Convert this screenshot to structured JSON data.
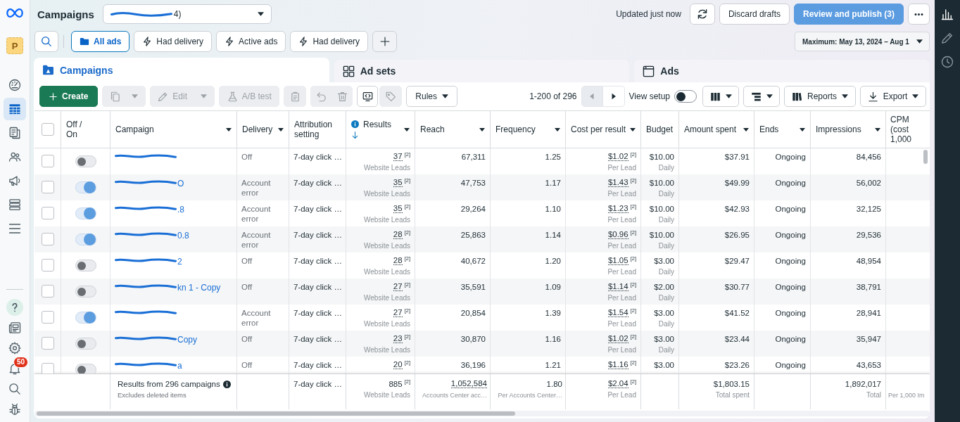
{
  "left_nav": {
    "top": [
      {
        "kind": "logo"
      },
      {
        "kind": "avatar",
        "label": "P"
      },
      {
        "kind": "icon",
        "selected": false
      },
      {
        "kind": "icon",
        "selected": true
      },
      {
        "kind": "icon",
        "selected": false
      },
      {
        "kind": "icon",
        "selected": false
      },
      {
        "kind": "icon",
        "selected": false
      },
      {
        "kind": "icon",
        "selected": false
      },
      {
        "kind": "icon",
        "selected": false
      }
    ],
    "bottom": [
      {
        "selected": false
      },
      {
        "selected": false
      },
      {
        "selected": false
      },
      {
        "selected": false,
        "badge": "50"
      },
      {
        "selected": false
      },
      {
        "selected": false
      }
    ]
  },
  "header": {
    "title": "Campaigns",
    "account_visible_part": "4)",
    "status": "Updated just now",
    "discard": {
      "label": "Discard drafts",
      "disabled": false
    },
    "publish": {
      "label": "Review and publish (3)",
      "disabled": true
    }
  },
  "filters": {
    "chips": [
      {
        "kind": "saved_view",
        "label": "All ads",
        "selected": true
      },
      {
        "kind": "quick_filter",
        "label": "Had delivery",
        "selected": false
      },
      {
        "kind": "quick_filter",
        "label": "Active ads",
        "selected": false
      },
      {
        "kind": "quick_filter",
        "label": "Had delivery",
        "selected": false
      }
    ],
    "date_range": "Maximum: May 13, 2024 – Aug 1"
  },
  "tabs": [
    {
      "label": "Campaigns",
      "selected": true
    },
    {
      "label": "Ad sets",
      "selected": false
    },
    {
      "label": "Ads",
      "selected": false
    }
  ],
  "toolbar": {
    "buttons": [
      {
        "kind": "create",
        "label": "Create",
        "disabled": false
      },
      {
        "kind": "duplicate",
        "disabled": true
      },
      {
        "kind": "edit",
        "label": "Edit",
        "disabled": true
      },
      {
        "kind": "ab_test",
        "label": "A/B test",
        "disabled": true
      },
      {
        "kind": "clipboard",
        "disabled": true
      },
      {
        "kind": "undo",
        "disabled": true
      },
      {
        "kind": "delete",
        "disabled": true
      },
      {
        "kind": "swap",
        "disabled": false
      },
      {
        "kind": "tag",
        "disabled": true
      },
      {
        "kind": "rules",
        "label": "Rules",
        "disabled": false
      }
    ],
    "pagination": {
      "label": "1-200 of 296",
      "prev_disabled": true,
      "next_disabled": false
    },
    "view_setup": {
      "label": "View setup",
      "on": false
    },
    "right_buttons": [
      {
        "kind": "columns"
      },
      {
        "kind": "breakdown"
      },
      {
        "kind": "reports",
        "label": "Reports"
      },
      {
        "kind": "export",
        "label": "Export"
      }
    ]
  },
  "table": {
    "header_checked": false,
    "columns": [
      {
        "label": "Off / On",
        "menu": false
      },
      {
        "label": "Campaign",
        "menu": true
      },
      {
        "label": "Delivery",
        "menu": true
      },
      {
        "label": "Attribution setting",
        "menu": false
      },
      {
        "label": "Results",
        "menu": true,
        "info": true,
        "sort_descending": true
      },
      {
        "label": "Reach",
        "menu": true
      },
      {
        "label": "Frequency",
        "menu": true
      },
      {
        "label": "Cost per result",
        "menu": true
      },
      {
        "label": "Budget",
        "menu": false
      },
      {
        "label": "Amount spent",
        "menu": true
      },
      {
        "label": "Ends",
        "menu": true
      },
      {
        "label": "Impressions",
        "menu": true
      },
      {
        "label": "CPM (cost 1,000",
        "menu": false
      }
    ],
    "rows": [
      {
        "checked": false,
        "on": false,
        "delivery": "Off",
        "attribution": "7-day click …",
        "results": {
          "value": "37",
          "note": "[2]",
          "sub": "Website Leads"
        },
        "reach": "67,311",
        "frequency": "1.25",
        "cost_per_result": {
          "value": "$1.02",
          "note": "[2]",
          "sub": "Per Lead"
        },
        "budget": {
          "value": "$10.00",
          "sub": "Daily"
        },
        "amount_spent": "$37.91",
        "ends": "Ongoing",
        "impressions": "84,456"
      },
      {
        "checked": false,
        "on": true,
        "campaign_visible_part": "O",
        "delivery": "Account error",
        "attribution": "7-day click …",
        "results": {
          "value": "35",
          "note": "[2]",
          "sub": "Website Leads"
        },
        "reach": "47,753",
        "frequency": "1.17",
        "cost_per_result": {
          "value": "$1.43",
          "note": "[2]",
          "sub": "Per Lead"
        },
        "budget": {
          "value": "$10.00",
          "sub": "Daily"
        },
        "amount_spent": "$49.99",
        "ends": "Ongoing",
        "impressions": "56,002"
      },
      {
        "checked": false,
        "on": true,
        "campaign_visible_part": ".8",
        "delivery": "Account error",
        "attribution": "7-day click …",
        "results": {
          "value": "35",
          "note": "[2]",
          "sub": "Website Leads"
        },
        "reach": "29,264",
        "frequency": "1.10",
        "cost_per_result": {
          "value": "$1.23",
          "note": "[2]",
          "sub": "Per Lead"
        },
        "budget": {
          "value": "$10.00",
          "sub": "Daily"
        },
        "amount_spent": "$42.93",
        "ends": "Ongoing",
        "impressions": "32,125"
      },
      {
        "checked": false,
        "on": true,
        "campaign_visible_part": "0.8",
        "delivery": "Account error",
        "attribution": "7-day click …",
        "results": {
          "value": "28",
          "note": "[2]",
          "sub": "Website Leads"
        },
        "reach": "25,863",
        "frequency": "1.14",
        "cost_per_result": {
          "value": "$0.96",
          "note": "[2]",
          "sub": "Per Lead"
        },
        "budget": {
          "value": "$10.00",
          "sub": "Daily"
        },
        "amount_spent": "$26.95",
        "ends": "Ongoing",
        "impressions": "29,536"
      },
      {
        "checked": false,
        "on": false,
        "campaign_visible_part": "2",
        "delivery": "Off",
        "attribution": "7-day click …",
        "results": {
          "value": "28",
          "note": "[2]",
          "sub": "Website Leads"
        },
        "reach": "40,672",
        "frequency": "1.20",
        "cost_per_result": {
          "value": "$1.05",
          "note": "[2]",
          "sub": "Per Lead"
        },
        "budget": {
          "value": "$3.00",
          "sub": "Daily"
        },
        "amount_spent": "$29.47",
        "ends": "Ongoing",
        "impressions": "48,954"
      },
      {
        "checked": false,
        "on": false,
        "campaign_visible_part": "kn 1 - Copy",
        "delivery": "Off",
        "attribution": "7-day click …",
        "results": {
          "value": "27",
          "note": "[2]",
          "sub": "Website Leads"
        },
        "reach": "35,591",
        "frequency": "1.09",
        "cost_per_result": {
          "value": "$1.14",
          "note": "[2]",
          "sub": "Per Lead"
        },
        "budget": {
          "value": "$2.00",
          "sub": "Daily"
        },
        "amount_spent": "$30.77",
        "ends": "Ongoing",
        "impressions": "38,791"
      },
      {
        "checked": false,
        "on": true,
        "delivery": "Account error",
        "attribution": "7-day click …",
        "results": {
          "value": "27",
          "note": "[2]",
          "sub": "Website Leads"
        },
        "reach": "20,854",
        "frequency": "1.39",
        "cost_per_result": {
          "value": "$1.54",
          "note": "[2]",
          "sub": "Per Lead"
        },
        "budget": {
          "value": "$3.00",
          "sub": "Daily"
        },
        "amount_spent": "$41.52",
        "ends": "Ongoing",
        "impressions": "28,941"
      },
      {
        "checked": false,
        "on": false,
        "campaign_visible_part": "Copy",
        "delivery": "Off",
        "attribution": "7-day click …",
        "results": {
          "value": "23",
          "note": "[2]",
          "sub": "Website Leads"
        },
        "reach": "30,870",
        "frequency": "1.16",
        "cost_per_result": {
          "value": "$1.02",
          "note": "[2]",
          "sub": "Per Lead"
        },
        "budget": {
          "value": "$3.00",
          "sub": "Daily"
        },
        "amount_spent": "$23.44",
        "ends": "Ongoing",
        "impressions": "35,947"
      },
      {
        "checked": false,
        "on": false,
        "campaign_visible_part": "a",
        "delivery": "Off",
        "attribution": "7-day click …",
        "results": {
          "value": "20",
          "note": "[2]"
        },
        "reach": "36,196",
        "frequency": "1.21",
        "cost_per_result": {
          "value": "$1.16",
          "note": "[2]"
        },
        "budget": {
          "value": "$3.00"
        },
        "amount_spent": "$23.26",
        "ends": "Ongoing",
        "impressions": "43,653"
      }
    ],
    "summary": {
      "label": "Results from 296 campaigns",
      "note": "Excludes deleted items",
      "attribution": "7-day click …",
      "results": {
        "value": "885",
        "note": "[2]",
        "sub": "Website Leads"
      },
      "reach": {
        "value": "1,052,584",
        "sub": "Accounts Center acc…"
      },
      "frequency": {
        "value": "1.80",
        "sub": "Per Accounts Center…"
      },
      "cost_per_result": {
        "value": "$2.04",
        "note": "[2]",
        "sub": "Per Lead"
      },
      "amount_spent": {
        "value": "$1,803.15",
        "sub": "Total spent"
      },
      "impressions": {
        "value": "1,892,017",
        "sub": "Total"
      },
      "cpm": {
        "sub": "Per 1,000 Im"
      }
    }
  },
  "right_rail": {
    "items": [
      {
        "selected": true
      },
      {
        "selected": false
      },
      {
        "selected": false
      }
    ]
  }
}
